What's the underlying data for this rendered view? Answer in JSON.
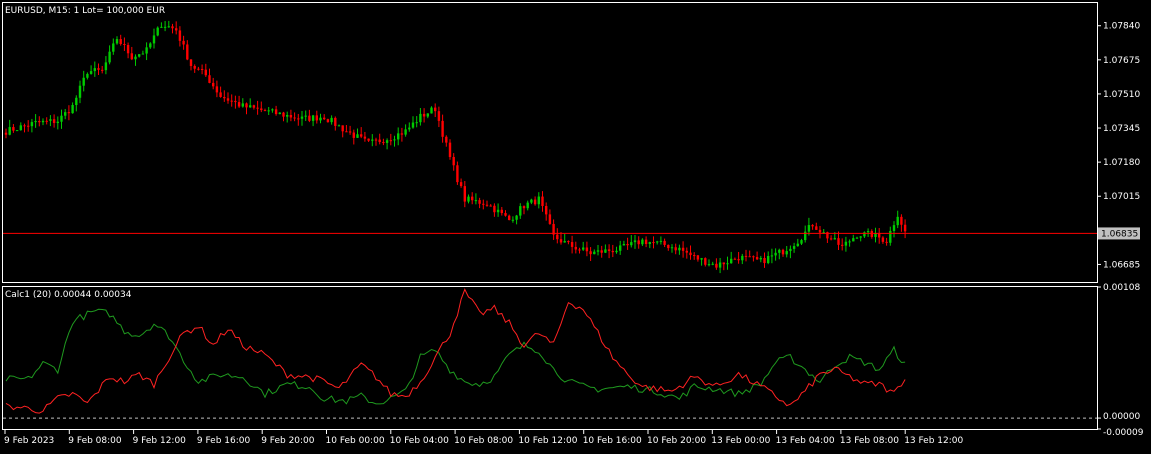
{
  "colors": {
    "background": "#000000",
    "frame": "#ffffff",
    "bull": "#00cc00",
    "bear": "#ff0000",
    "price_line": "#ff0000",
    "price_label_bg": "#c0c0c0",
    "series_green": "#1f9a1f",
    "series_red": "#ff2222",
    "zero_line": "#c0c0c0"
  },
  "header": {
    "main_title": "EURUSD, M15:  1 Lot= 100,000 EUR",
    "indicator_title": "Calc1 (20) 0.00044 0.00034"
  },
  "chart_data": [
    {
      "type": "candlestick",
      "symbol": "EURUSD",
      "timeframe": "M15",
      "ylim": [
        1.066,
        1.0795
      ],
      "y_ticks": [
        "1.07840",
        "1.07675",
        "1.07510",
        "1.07345",
        "1.07180",
        "1.07015",
        "1.06685"
      ],
      "current_price": "1.06835",
      "anchors": [
        [
          0,
          1.0733
        ],
        [
          8,
          1.0737
        ],
        [
          14,
          1.0738
        ],
        [
          18,
          1.0745
        ],
        [
          22,
          1.0762
        ],
        [
          26,
          1.0762
        ],
        [
          30,
          1.0778
        ],
        [
          34,
          1.0769
        ],
        [
          38,
          1.0772
        ],
        [
          42,
          1.0785
        ],
        [
          46,
          1.0782
        ],
        [
          50,
          1.0765
        ],
        [
          54,
          1.076
        ],
        [
          58,
          1.075
        ],
        [
          64,
          1.0745
        ],
        [
          72,
          1.0742
        ],
        [
          80,
          1.0739
        ],
        [
          86,
          1.074
        ],
        [
          92,
          1.0733
        ],
        [
          98,
          1.0727
        ],
        [
          104,
          1.073
        ],
        [
          108,
          1.0733
        ],
        [
          112,
          1.074
        ],
        [
          116,
          1.0744
        ],
        [
          120,
          1.072
        ],
        [
          124,
          1.07
        ],
        [
          130,
          1.0698
        ],
        [
          136,
          1.069
        ],
        [
          140,
          1.0697
        ],
        [
          144,
          1.07
        ],
        [
          148,
          1.0682
        ],
        [
          152,
          1.0678
        ],
        [
          158,
          1.0674
        ],
        [
          166,
          1.0676
        ],
        [
          172,
          1.068
        ],
        [
          178,
          1.0678
        ],
        [
          182,
          1.0676
        ],
        [
          186,
          1.0672
        ],
        [
          192,
          1.0668
        ],
        [
          198,
          1.0672
        ],
        [
          204,
          1.067
        ],
        [
          210,
          1.0675
        ],
        [
          214,
          1.068
        ],
        [
          218,
          1.0688
        ],
        [
          222,
          1.0682
        ],
        [
          226,
          1.0677
        ],
        [
          230,
          1.0683
        ],
        [
          234,
          1.0683
        ],
        [
          238,
          1.068
        ],
        [
          241,
          1.0693
        ],
        [
          243,
          1.0684
        ]
      ]
    },
    {
      "type": "line",
      "name": "Calc1 (20)",
      "values_printed": [
        "0.00044",
        "0.00034"
      ],
      "ylim": [
        -9e-05,
        0.00108
      ],
      "y_ticks": [
        "0.00108",
        "0.00000",
        "-0.00009"
      ],
      "x_ticks": [
        "9 Feb 2023",
        "9 Feb 08:00",
        "9 Feb 12:00",
        "9 Feb 16:00",
        "9 Feb 20:00",
        "10 Feb 00:00",
        "10 Feb 04:00",
        "10 Feb 08:00",
        "10 Feb 12:00",
        "10 Feb 16:00",
        "10 Feb 20:00",
        "13 Feb 00:00",
        "13 Feb 04:00",
        "13 Feb 08:00",
        "13 Feb 12:00"
      ],
      "series": [
        {
          "color": "#1f9a1f",
          "anchors": [
            [
              0,
              0.00032
            ],
            [
              6,
              0.00032
            ],
            [
              10,
              0.00045
            ],
            [
              14,
              0.0004
            ],
            [
              18,
              0.0008
            ],
            [
              24,
              0.00088
            ],
            [
              28,
              0.00086
            ],
            [
              32,
              0.00072
            ],
            [
              36,
              0.00068
            ],
            [
              40,
              0.00078
            ],
            [
              44,
              0.00068
            ],
            [
              48,
              0.00048
            ],
            [
              52,
              0.0003
            ],
            [
              58,
              0.00036
            ],
            [
              64,
              0.00034
            ],
            [
              70,
              0.0002
            ],
            [
              76,
              0.00028
            ],
            [
              82,
              0.00026
            ],
            [
              86,
              0.00016
            ],
            [
              92,
              0.00014
            ],
            [
              96,
              0.00018
            ],
            [
              100,
              0.00012
            ],
            [
              104,
              0.00016
            ],
            [
              108,
              0.00022
            ],
            [
              112,
              0.0005
            ],
            [
              116,
              0.00056
            ],
            [
              120,
              0.0004
            ],
            [
              124,
              0.0003
            ],
            [
              128,
              0.00028
            ],
            [
              132,
              0.00034
            ],
            [
              136,
              0.00052
            ],
            [
              140,
              0.0006
            ],
            [
              144,
              0.00056
            ],
            [
              148,
              0.0004
            ],
            [
              152,
              0.0003
            ],
            [
              156,
              0.00026
            ],
            [
              160,
              0.00024
            ],
            [
              168,
              0.00026
            ],
            [
              176,
              0.00022
            ],
            [
              182,
              0.00016
            ],
            [
              186,
              0.00026
            ],
            [
              192,
              0.00024
            ],
            [
              198,
              0.0002
            ],
            [
              204,
              0.00028
            ],
            [
              208,
              0.00046
            ],
            [
              212,
              0.0005
            ],
            [
              216,
              0.0004
            ],
            [
              220,
              0.0003
            ],
            [
              224,
              0.00044
            ],
            [
              228,
              0.0005
            ],
            [
              232,
              0.00046
            ],
            [
              236,
              0.0004
            ],
            [
              240,
              0.00056
            ],
            [
              243,
              0.00044
            ]
          ]
        },
        {
          "color": "#ff2222",
          "anchors": [
            [
              0,
              0.0001
            ],
            [
              6,
              8e-05
            ],
            [
              10,
              6e-05
            ],
            [
              14,
              0.00016
            ],
            [
              18,
              0.0002
            ],
            [
              22,
              0.00012
            ],
            [
              28,
              0.00034
            ],
            [
              32,
              0.0003
            ],
            [
              36,
              0.00036
            ],
            [
              40,
              0.00028
            ],
            [
              44,
              0.0005
            ],
            [
              48,
              0.0007
            ],
            [
              52,
              0.00076
            ],
            [
              56,
              0.0006
            ],
            [
              60,
              0.00074
            ],
            [
              64,
              0.0006
            ],
            [
              70,
              0.00052
            ],
            [
              76,
              0.00036
            ],
            [
              82,
              0.00034
            ],
            [
              86,
              0.0003
            ],
            [
              90,
              0.00024
            ],
            [
              96,
              0.00044
            ],
            [
              100,
              0.00034
            ],
            [
              104,
              0.0002
            ],
            [
              108,
              0.00018
            ],
            [
              112,
              0.0003
            ],
            [
              116,
              0.0005
            ],
            [
              120,
              0.0007
            ],
            [
              124,
              0.00104
            ],
            [
              128,
              0.00086
            ],
            [
              132,
              0.0009
            ],
            [
              136,
              0.00078
            ],
            [
              140,
              0.0006
            ],
            [
              144,
              0.0007
            ],
            [
              148,
              0.0006
            ],
            [
              152,
              0.00096
            ],
            [
              156,
              0.0009
            ],
            [
              160,
              0.0007
            ],
            [
              164,
              0.0005
            ],
            [
              168,
              0.00036
            ],
            [
              172,
              0.00026
            ],
            [
              176,
              0.00024
            ],
            [
              180,
              0.00022
            ],
            [
              186,
              0.00034
            ],
            [
              192,
              0.00026
            ],
            [
              198,
              0.00036
            ],
            [
              204,
              0.00026
            ],
            [
              208,
              0.00018
            ],
            [
              212,
              0.0001
            ],
            [
              216,
              0.00022
            ],
            [
              220,
              0.00036
            ],
            [
              224,
              0.0004
            ],
            [
              228,
              0.00034
            ],
            [
              232,
              0.00028
            ],
            [
              236,
              0.00028
            ],
            [
              240,
              0.0002
            ],
            [
              243,
              0.00034
            ]
          ]
        }
      ]
    }
  ]
}
